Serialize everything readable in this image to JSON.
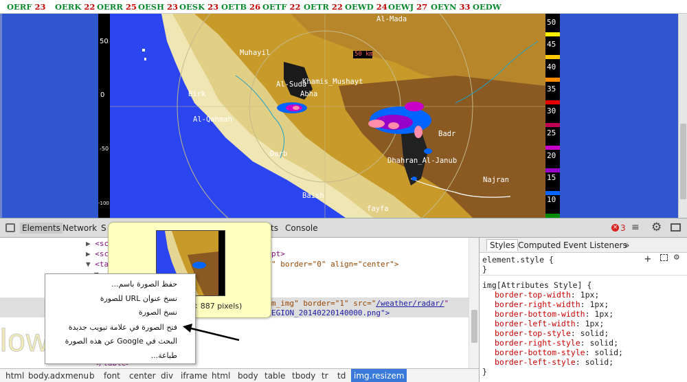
{
  "stations": [
    {
      "code": "OERF",
      "value": "23"
    },
    {
      "code": "OERK",
      "value": "22"
    },
    {
      "code": "OERR",
      "value": "25"
    },
    {
      "code": "OESH",
      "value": "23"
    },
    {
      "code": "OESK",
      "value": "23"
    },
    {
      "code": "OETB",
      "value": "26"
    },
    {
      "code": "OETF",
      "value": "22"
    },
    {
      "code": "OETR",
      "value": "22"
    },
    {
      "code": "OEWD",
      "value": "24"
    },
    {
      "code": "OEWJ",
      "value": "27"
    },
    {
      "code": "OEYN",
      "value": "33"
    },
    {
      "code": "OEDW",
      "value": ""
    }
  ],
  "radar": {
    "cities": [
      "Al-Mada",
      "Muhayil",
      "Al-Suda",
      "Khamis_Mushayt",
      "Abha",
      "Birk",
      "Al-Qahmah",
      "Badr",
      "Darb",
      "Dhahran_Al-Janub",
      "Najran",
      "Baish",
      "fayfa"
    ],
    "range_label": "50 km",
    "axis_labels": [
      "50",
      "0",
      "-50",
      "-100"
    ],
    "scale_values": [
      "50",
      "45",
      "40",
      "35",
      "30",
      "25",
      "20",
      "15",
      "10"
    ],
    "scale_colors": [
      "#fff000",
      "#ffc800",
      "#ff8c00",
      "#e40000",
      "#c00050",
      "#c800c8",
      "#9600c8",
      "#0064ff",
      "#008c00"
    ]
  },
  "devtools": {
    "tabs": [
      "Elements",
      "Network",
      "S",
      "ts",
      "Console"
    ],
    "error_count": "3",
    "code_lines": [
      {
        "text": "<sc",
        "tri": "▶"
      },
      {
        "text": "<sc",
        "tri": "▶"
      },
      {
        "text": "<ta",
        "tri": "▼"
      },
      {
        "text": "",
        "tri": "▼"
      }
    ],
    "script_fragment": "pt>",
    "table_attrs": "\" border=\"0\" align=\"center\">",
    "img_line1_a": "m_img\" border=\"1\" src=\"",
    "img_line1_src": "/weather/radar/",
    "img_line2": "EGION_20140220140000.png\">",
    "end_table": "</table>",
    "breadcrumbs": [
      "html",
      "body.adxmenu",
      "b",
      "font",
      "center",
      "div",
      "iframe",
      "html",
      "body",
      "table",
      "tbody",
      "tr",
      "td",
      "img.resizem"
    ],
    "styles_tabs": [
      "Styles",
      "Computed",
      "Event Listeners"
    ],
    "styles_more": "»",
    "element_style": "element.style {",
    "close_brace": "}",
    "rule_selector": "img[Attributes Style] {",
    "rule_props": [
      {
        "prop": "border-top-width",
        "value": "1px;"
      },
      {
        "prop": "border-right-width",
        "value": "1px;"
      },
      {
        "prop": "border-bottom-width",
        "value": "1px;"
      },
      {
        "prop": "border-left-width",
        "value": "1px;"
      },
      {
        "prop": "border-top-style",
        "value": "solid;"
      },
      {
        "prop": "border-right-style",
        "value": "solid;"
      },
      {
        "prop": "border-bottom-style",
        "value": "solid;"
      },
      {
        "prop": "border-left-style",
        "value": "solid;"
      }
    ]
  },
  "tooltip": {
    "dims": "ral: 927 × 887 pixels)"
  },
  "context_menu": [
    "حفظ الصورة باسم...",
    "نسخ عنوان URL للصورة",
    "نسخ الصورة",
    "فتح الصورة في علامة تبويب جديدة",
    "البحث في Google عن هذه الصورة",
    "طباعة..."
  ],
  "watermark": "low"
}
